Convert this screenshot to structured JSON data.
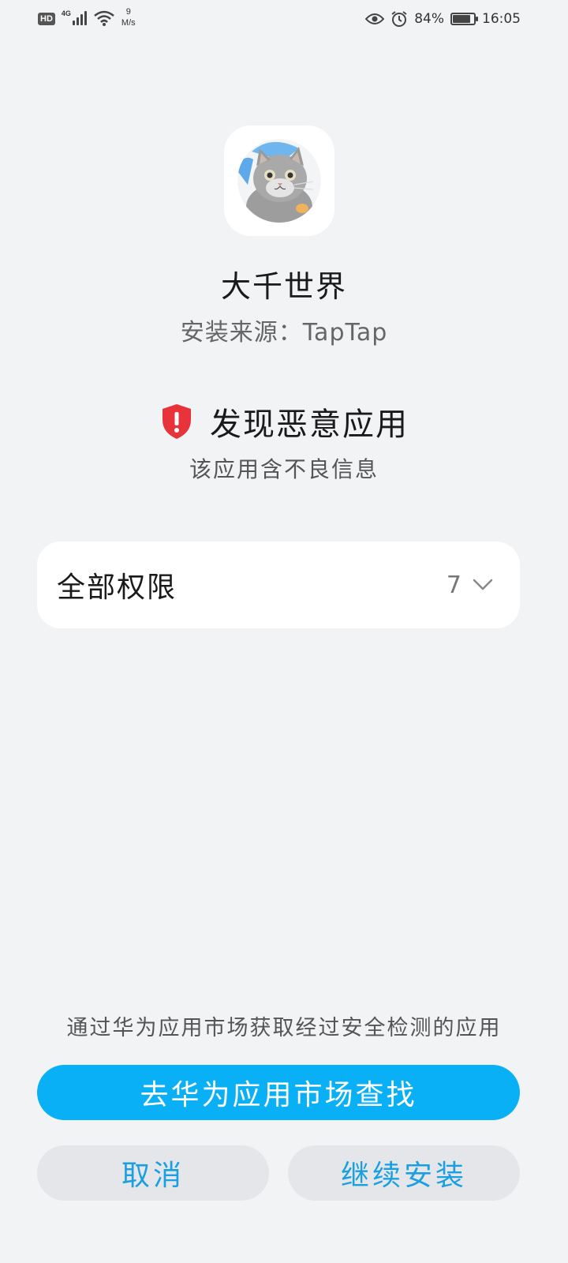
{
  "status_bar": {
    "hd": "HD",
    "network_gen": "4G",
    "speed_value": "9",
    "speed_unit": "M/s",
    "battery_percent": "84%",
    "battery_level": 0.84,
    "time": "16:05",
    "icons": [
      "hd-icon",
      "signal-icon",
      "wifi-icon",
      "eye-icon",
      "alarm-icon",
      "battery-icon"
    ]
  },
  "app": {
    "name": "大千世界",
    "source": "安装来源：TapTap",
    "icon": "cat-app-icon"
  },
  "warning": {
    "title": "发现恶意应用",
    "description": "该应用含不良信息",
    "icon": "shield-alert-icon",
    "color": "#e8333a"
  },
  "permissions": {
    "label": "全部权限",
    "count": "7",
    "icon": "chevron-down-icon"
  },
  "footer": {
    "hint": "通过华为应用市场获取经过安全检测的应用",
    "primary_label": "去华为应用市场查找",
    "cancel_label": "取消",
    "continue_label": "继续安装",
    "accent_color": "#0ab0f5"
  }
}
